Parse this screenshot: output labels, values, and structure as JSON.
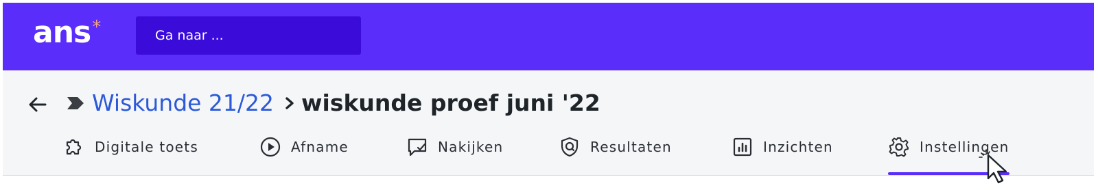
{
  "header": {
    "logo_text": "ans",
    "logo_star": "*",
    "search_placeholder": "Ga naar ..."
  },
  "breadcrumb": {
    "parent": "Wiskunde 21/22",
    "current": "wiskunde proef juni '22"
  },
  "tabs": [
    {
      "label": "Digitale toets",
      "icon": "puzzle-icon"
    },
    {
      "label": "Afname",
      "icon": "play-circle-icon"
    },
    {
      "label": "Nakijken",
      "icon": "chat-check-icon"
    },
    {
      "label": "Resultaten",
      "icon": "shield-icon"
    },
    {
      "label": "Inzichten",
      "icon": "bar-chart-icon"
    },
    {
      "label": "Instellingen",
      "icon": "gear-icon",
      "active": true
    }
  ],
  "colors": {
    "brand": "#5a2dfa",
    "search_bg": "#3a0bd9",
    "link": "#2b59d9",
    "logo_star": "#f3a58a"
  }
}
